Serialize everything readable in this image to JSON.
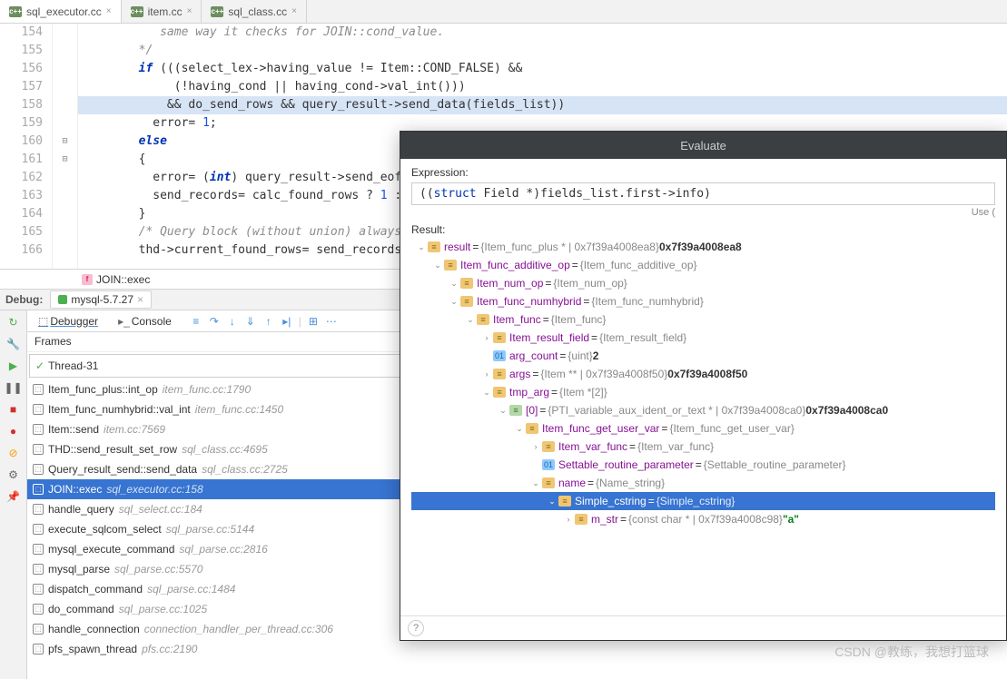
{
  "tabs": [
    {
      "name": "sql_executor.cc",
      "active": true
    },
    {
      "name": "item.cc",
      "active": false
    },
    {
      "name": "sql_class.cc",
      "active": false
    }
  ],
  "code": {
    "lines": [
      {
        "n": 154,
        "text": "           same way it checks for JOIN::cond_value.",
        "cls": "cm"
      },
      {
        "n": 155,
        "text": "        */",
        "cls": "cm"
      },
      {
        "n": 156,
        "text": "        if (((select_lex->having_value != Item::COND_FALSE) &&",
        "kw": "if"
      },
      {
        "n": 157,
        "text": "             (!having_cond || having_cond->val_int()))"
      },
      {
        "n": 158,
        "text": "            && do_send_rows && query_result->send_data(fields_list))",
        "hl": true
      },
      {
        "n": 159,
        "text": "          error= 1;",
        "num": "1"
      },
      {
        "n": 160,
        "text": "        else",
        "kw": "else"
      },
      {
        "n": 161,
        "text": "        {"
      },
      {
        "n": 162,
        "text": "          error= (int) query_result->send_eof",
        "kw": "int"
      },
      {
        "n": 163,
        "text": "          send_records= calc_found_rows ? 1 :",
        "num": "1"
      },
      {
        "n": 164,
        "text": "        }"
      },
      {
        "n": 165,
        "text": "        /* Query block (without union) always",
        "cls": "cm"
      },
      {
        "n": 166,
        "text": "        thd->current_found_rows= send_records"
      }
    ]
  },
  "breadcrumb": {
    "symbol": "JOIN::exec",
    "icon": "f"
  },
  "debug": {
    "label": "Debug:",
    "config": "mysql-5.7.27",
    "tabs": {
      "debugger": "Debugger",
      "console": "Console"
    },
    "frames_hdr": "Frames",
    "thread": "Thread-31",
    "frames": [
      {
        "name": "Item_func_plus::int_op",
        "loc": "item_func.cc:1790"
      },
      {
        "name": "Item_func_numhybrid::val_int",
        "loc": "item_func.cc:1450"
      },
      {
        "name": "Item::send",
        "loc": "item.cc:7569"
      },
      {
        "name": "THD::send_result_set_row",
        "loc": "sql_class.cc:4695"
      },
      {
        "name": "Query_result_send::send_data",
        "loc": "sql_class.cc:2725"
      },
      {
        "name": "JOIN::exec",
        "loc": "sql_executor.cc:158",
        "sel": true
      },
      {
        "name": "handle_query",
        "loc": "sql_select.cc:184"
      },
      {
        "name": "execute_sqlcom_select",
        "loc": "sql_parse.cc:5144"
      },
      {
        "name": "mysql_execute_command",
        "loc": "sql_parse.cc:2816"
      },
      {
        "name": "mysql_parse",
        "loc": "sql_parse.cc:5570"
      },
      {
        "name": "dispatch_command",
        "loc": "sql_parse.cc:1484"
      },
      {
        "name": "do_command",
        "loc": "sql_parse.cc:1025"
      },
      {
        "name": "handle_connection",
        "loc": "connection_handler_per_thread.cc:306"
      },
      {
        "name": "pfs_spawn_thread",
        "loc": "pfs.cc:2190"
      }
    ]
  },
  "evaluate": {
    "title": "Evaluate",
    "expr_label": "Expression:",
    "expr_pre": "((",
    "expr_kw": "struct",
    "expr_post": " Field *)fields_list.first->info)",
    "hint": "Use (",
    "result_label": "Result:",
    "tree": [
      {
        "d": 0,
        "a": "v",
        "t": "obj",
        "n": "result",
        "v": "{Item_func_plus * | 0x7f39a4008ea8}",
        "b": "0x7f39a4008ea8"
      },
      {
        "d": 1,
        "a": "v",
        "t": "obj",
        "n": "Item_func_additive_op",
        "v": "{Item_func_additive_op}"
      },
      {
        "d": 2,
        "a": "v",
        "t": "obj",
        "n": "Item_num_op",
        "v": "{Item_num_op}"
      },
      {
        "d": 2,
        "a": "v",
        "t": "obj",
        "n": "Item_func_numhybrid",
        "v": "{Item_func_numhybrid}"
      },
      {
        "d": 3,
        "a": "v",
        "t": "obj",
        "n": "Item_func",
        "v": "{Item_func}"
      },
      {
        "d": 4,
        "a": ">",
        "t": "obj",
        "n": "Item_result_field",
        "v": "{Item_result_field}"
      },
      {
        "d": 4,
        "a": "",
        "t": "prim",
        "n": "arg_count",
        "v": "{uint}",
        "b": "2"
      },
      {
        "d": 4,
        "a": ">",
        "t": "obj",
        "n": "args",
        "v": "{Item ** | 0x7f39a4008f50}",
        "b": "0x7f39a4008f50"
      },
      {
        "d": 4,
        "a": "v",
        "t": "obj",
        "n": "tmp_arg",
        "v": "{Item *[2]}"
      },
      {
        "d": 5,
        "a": "v",
        "t": "arr",
        "n": "[0]",
        "v": "{PTI_variable_aux_ident_or_text * | 0x7f39a4008ca0}",
        "b": "0x7f39a4008ca0"
      },
      {
        "d": 6,
        "a": "v",
        "t": "obj",
        "n": "Item_func_get_user_var",
        "v": "{Item_func_get_user_var}"
      },
      {
        "d": 7,
        "a": ">",
        "t": "obj",
        "n": "Item_var_func",
        "v": "{Item_var_func}"
      },
      {
        "d": 7,
        "a": "",
        "t": "prim",
        "n": "Settable_routine_parameter",
        "v": "{Settable_routine_parameter}"
      },
      {
        "d": 7,
        "a": "v",
        "t": "obj",
        "n": "name",
        "v": "{Name_string}"
      },
      {
        "d": 8,
        "a": "v",
        "t": "obj",
        "n": "Simple_cstring",
        "v": "{Simple_cstring}",
        "sel": true
      },
      {
        "d": 9,
        "a": ">",
        "t": "obj",
        "n": "m_str",
        "v": "{const char * | 0x7f39a4008c98}",
        "s": "\"a\""
      }
    ]
  },
  "watermark": "CSDN @教练，我想打篮球"
}
